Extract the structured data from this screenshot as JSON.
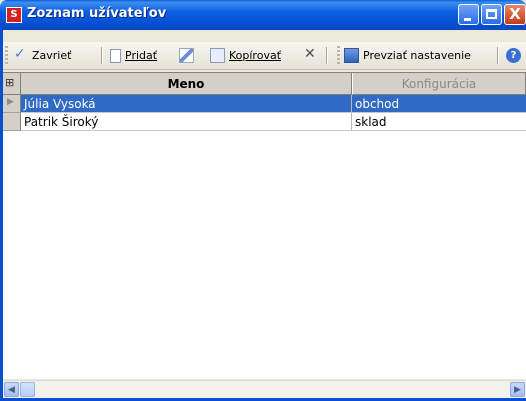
{
  "window": {
    "title": "Zoznam užívateľov",
    "close_glyph": "X"
  },
  "toolbar": {
    "close_label": "Zavrieť",
    "add_label": "Pridať",
    "copy_label": "Kopírovať",
    "import_label": "Prevziať nastavenie",
    "help_glyph": "?"
  },
  "grid": {
    "columns": [
      "Meno",
      "Konfigurácia"
    ],
    "rows": [
      {
        "name": "Júlia Vysoká",
        "config": "obchod",
        "selected": true
      },
      {
        "name": "Patrik Široký",
        "config": "sklad",
        "selected": false
      }
    ]
  },
  "icons": [
    "app-icon",
    "check-icon",
    "page-icon",
    "edit-icon",
    "copy-icon",
    "delete-icon",
    "import-icon",
    "help-icon",
    "column-chooser-icon"
  ],
  "colors": {
    "titlebar": "#0554d7",
    "selection": "#316ac5",
    "close_button": "#c63b16"
  }
}
